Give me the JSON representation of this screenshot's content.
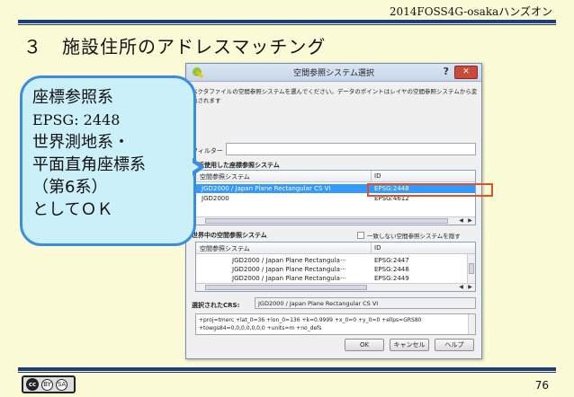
{
  "header": {
    "event": "2014FOSS4G-osakaハンズオン"
  },
  "slide": {
    "number": "３",
    "title": "施設住所のアドレスマッチング",
    "page": "76"
  },
  "callout": {
    "lines": [
      "座標参照系",
      "EPSG: 2448",
      "世界測地系・",
      "平面直角座標系",
      "（第6系）",
      "としてＯＫ"
    ]
  },
  "dialog": {
    "title": "空間参照システム選択",
    "help_label": "?",
    "close_label": "✕",
    "description": "ベクタファイルの空間参照システムを選んでください。データのポイントはレイヤの空間参照システムから変換されます",
    "filter_label": "フィルター",
    "filter_value": "",
    "recent": {
      "label": "最近使用した座標参照システム",
      "col_crs": "空間参照システム",
      "col_id": "ID",
      "rows": [
        {
          "name": "JGD2000 / Japan Plane Rectangular CS VI",
          "id": "EPSG:2448",
          "selected": true
        },
        {
          "name": "JGD2000",
          "id": "EPSG:4612",
          "selected": false
        }
      ]
    },
    "world": {
      "label": "世界中の空間参照システム",
      "hide_label": "一致しない空間参照システムを隠す",
      "col_crs": "空間参照システム",
      "col_id": "ID",
      "rows": [
        {
          "name": "JGD2000 / Japan Plane Rectangula···",
          "id": "EPSG:2447"
        },
        {
          "name": "JGD2000 / Japan Plane Rectangula···",
          "id": "EPSG:2448"
        },
        {
          "name": "JGD2000 / Japan Plane Rectangula···",
          "id": "EPSG:2449"
        }
      ]
    },
    "selected": {
      "label": "選択されたCRS:",
      "value": "JGD2000 / Japan Plane Rectangular CS VI"
    },
    "proj_lines": [
      "+proj=tmerc +lat_0=36 +lon_0=136 +k=0.9999 +x_0=0 +y_0=0 +ellps=GRS80",
      "+towgs84=0,0,0,0,0,0,0 +units=m +no_defs"
    ],
    "buttons": {
      "ok": "OK",
      "cancel": "キャンセル",
      "help": "ヘルプ"
    }
  },
  "license": {
    "cc": "cc",
    "by": "BY",
    "sa": "SA"
  },
  "colors": {
    "accent": "#1f3d7a",
    "callout_fill": "#ccf0fa",
    "callout_border": "#3a8de0",
    "highlight": "#e0502a",
    "selection": "#3399ff"
  }
}
